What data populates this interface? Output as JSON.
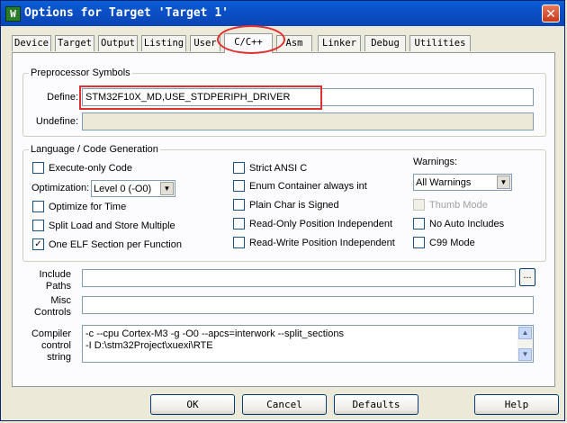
{
  "window": {
    "title": "Options for Target 'Target 1'",
    "icon": "keil-app-icon",
    "close_label": "✕"
  },
  "tabs": [
    {
      "label": "Device"
    },
    {
      "label": "Target"
    },
    {
      "label": "Output"
    },
    {
      "label": "Listing"
    },
    {
      "label": "User"
    },
    {
      "label": "C/C++",
      "active": true
    },
    {
      "label": "Asm"
    },
    {
      "label": "Linker"
    },
    {
      "label": "Debug"
    },
    {
      "label": "Utilities"
    }
  ],
  "preprocessor": {
    "group_label": "Preprocessor Symbols",
    "define_label": "Define:",
    "define_value": "STM32F10X_MD,USE_STDPERIPH_DRIVER",
    "undefine_label": "Undefine:",
    "undefine_value": ""
  },
  "language": {
    "group_label": "Language / Code Generation",
    "execute_only": {
      "label": "Execute-only Code",
      "checked": false
    },
    "optimization_label": "Optimization:",
    "optimization_value": "Level 0 (-O0)",
    "optimize_time": {
      "label": "Optimize for Time",
      "checked": false
    },
    "split_load": {
      "label": "Split Load and Store Multiple",
      "checked": false
    },
    "one_elf": {
      "label": "One ELF Section per Function",
      "checked": true,
      "mark": "✓"
    },
    "strict_ansi": {
      "label": "Strict ANSI C",
      "checked": false
    },
    "enum_container": {
      "label": "Enum Container always int",
      "checked": false
    },
    "plain_char": {
      "label": "Plain Char is Signed",
      "checked": false
    },
    "ro_position": {
      "label": "Read-Only Position Independent",
      "checked": false
    },
    "rw_position": {
      "label": "Read-Write Position Independent",
      "checked": false
    },
    "warnings_label": "Warnings:",
    "warnings_value": "All Warnings",
    "thumb_mode": {
      "label": "Thumb Mode",
      "checked": false,
      "disabled": true
    },
    "no_auto_includes": {
      "label": "No Auto Includes",
      "checked": false
    },
    "c99_mode": {
      "label": "C99 Mode",
      "checked": false
    }
  },
  "paths": {
    "include_label_1": "Include",
    "include_label_2": "Paths",
    "include_value": "",
    "browse_label": "...",
    "misc_label_1": "Misc",
    "misc_label_2": "Controls",
    "misc_value": ""
  },
  "compiler": {
    "label_1": "Compiler",
    "label_2": "control",
    "label_3": "string",
    "line_1": "-c --cpu Cortex-M3 -g -O0 --apcs=interwork --split_sections",
    "line_2": "-I D:\\stm32Project\\xuexi\\RTE"
  },
  "buttons": {
    "ok": "OK",
    "cancel": "Cancel",
    "defaults": "Defaults",
    "help": "Help"
  },
  "colors": {
    "titlebar": "#0b50c6",
    "highlight": "#e03030",
    "dialog_bg": "#ece9d8"
  }
}
